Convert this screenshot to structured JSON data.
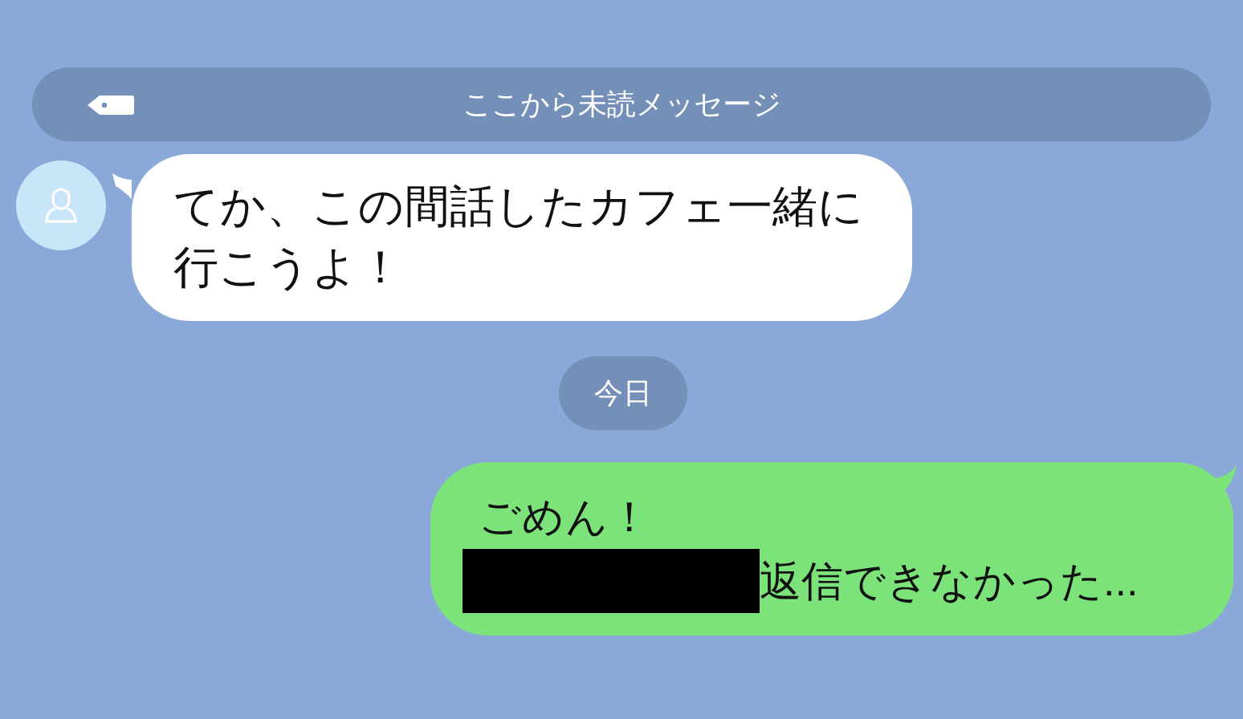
{
  "unread_banner": {
    "label": "ここから未読メッセージ"
  },
  "messages": [
    {
      "kind": "incoming",
      "text": "てか、この間話したカフェ一緒に行こうよ！"
    },
    {
      "kind": "date",
      "text": "今日"
    },
    {
      "kind": "outgoing",
      "lines": [
        {
          "text": "ごめん！",
          "redacted": false
        },
        {
          "text": "返信できなかった...",
          "redacted": true
        }
      ]
    }
  ]
}
